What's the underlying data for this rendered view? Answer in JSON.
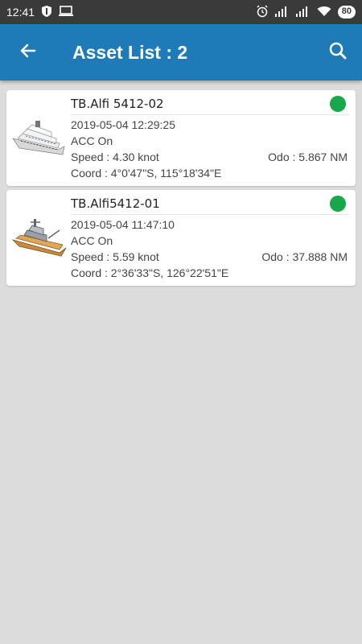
{
  "status_bar": {
    "time": "12:41",
    "battery": "80",
    "icons": [
      "shield-icon",
      "screen-icon",
      "alarm-icon",
      "signal-icon",
      "signal-icon",
      "wifi-icon",
      "battery-icon"
    ]
  },
  "app_bar": {
    "title": "Asset List : 2",
    "back_icon": "arrow-left-icon",
    "search_icon": "search-icon",
    "color": "#1e7bb8"
  },
  "assets": [
    {
      "name": "TB.Alfi 5412-02",
      "datetime": "2019-05-04 12:29:25",
      "acc": "ACC On",
      "speed": "Speed : 4.30  knot",
      "odo": "Odo : 5.867 NM",
      "coord": "Coord : 4°0'47\"S, 115°18'34\"E",
      "status_color": "#17a84b",
      "icon": "cruise-ship-icon"
    },
    {
      "name": "TB.Alfi5412-01",
      "datetime": "2019-05-04 11:47:10",
      "acc": "ACC On",
      "speed": "Speed : 5.59  knot",
      "odo": "Odo : 37.888 NM",
      "coord": "Coord : 2°36'33\"S, 126°22'51\"E",
      "status_color": "#17a84b",
      "icon": "cargo-ship-icon"
    }
  ]
}
